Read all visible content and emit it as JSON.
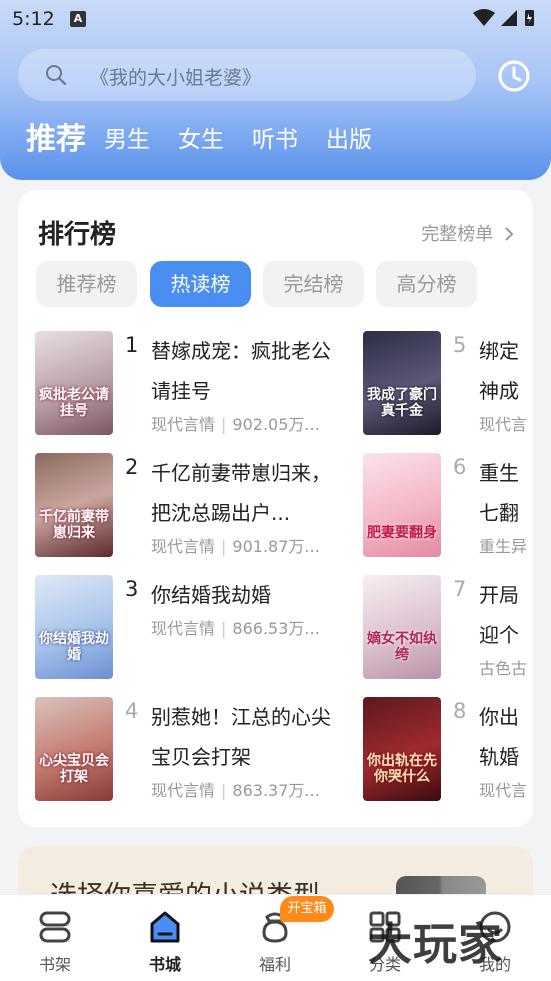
{
  "status_bar": {
    "time": "5:12",
    "notification_icon": "A"
  },
  "search": {
    "placeholder": "《我的大小姐老婆》"
  },
  "top_tabs": [
    {
      "label": "推荐",
      "active": true
    },
    {
      "label": "男生"
    },
    {
      "label": "女生"
    },
    {
      "label": "听书"
    },
    {
      "label": "出版"
    }
  ],
  "ranking": {
    "title": "排行榜",
    "more_label": "完整榜单",
    "tabs": [
      {
        "label": "推荐榜"
      },
      {
        "label": "热读榜",
        "active": true
      },
      {
        "label": "完结榜"
      },
      {
        "label": "高分榜"
      }
    ],
    "books": [
      {
        "rank": "1",
        "title": "替嫁成宠：疯批老公请挂号",
        "genre": "现代言情",
        "reads": "902.05万...",
        "cover_text": "疯批老公请挂号"
      },
      {
        "rank": "2",
        "title": "千亿前妻带崽归来，把沈总踢出户...",
        "genre": "现代言情",
        "reads": "901.87万...",
        "cover_text": "千亿前妻带崽归来"
      },
      {
        "rank": "3",
        "title": "你结婚我劫婚",
        "genre": "现代言情",
        "reads": "866.53万...",
        "cover_text": "你结婚我劫婚"
      },
      {
        "rank": "4",
        "title": "别惹她！江总的心尖宝贝会打架",
        "genre": "现代言情",
        "reads": "863.37万...",
        "cover_text": "心尖宝贝会打架"
      },
      {
        "rank": "5",
        "title": "绑定神成了豪",
        "genre": "现代言",
        "cover_text": "我成了豪门真千金"
      },
      {
        "rank": "6",
        "title": "重生七翻身",
        "genre": "重生异",
        "cover_text": "肥妻要翻身"
      },
      {
        "rank": "7",
        "title": "开局迎个纨绔",
        "genre": "古色古",
        "cover_text": "嫡女不如纨绔"
      },
      {
        "rank": "8",
        "title": "你出轨婚你哭",
        "genre": "现代言",
        "cover_text": "你出轨在先你哭什么"
      }
    ]
  },
  "promo": {
    "text": "选择你喜爱的小说类型"
  },
  "bottom_nav": [
    {
      "label": "书架",
      "icon": "bookshelf-icon"
    },
    {
      "label": "书城",
      "icon": "bookstore-icon",
      "active": true
    },
    {
      "label": "福利",
      "icon": "welfare-icon",
      "badge": "开宝箱"
    },
    {
      "label": "分类",
      "icon": "category-icon"
    },
    {
      "label": "我的",
      "icon": "profile-icon"
    }
  ],
  "watermark": "大玩家",
  "colors": {
    "accent": "#4a8ef4",
    "badge": "#ff8a1a",
    "header_top": "#c9daf7",
    "header_bottom": "#5a92ec"
  }
}
